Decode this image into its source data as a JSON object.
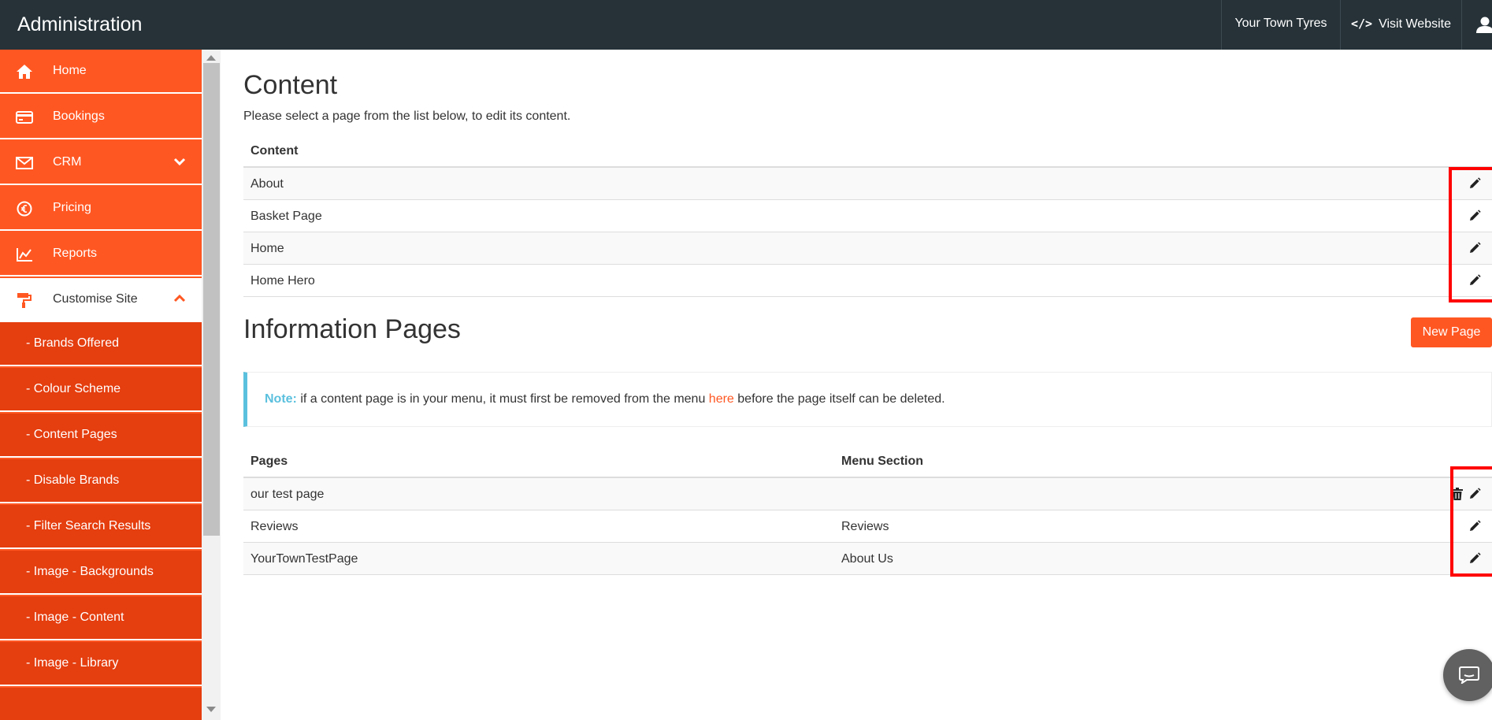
{
  "header": {
    "brand": "Administration",
    "store_name": "Your Town Tyres",
    "visit_website": "Visit Website",
    "visit_icon": "</>"
  },
  "sidebar": {
    "items": [
      {
        "label": "Home",
        "icon": "home-icon"
      },
      {
        "label": "Bookings",
        "icon": "credit-card-icon"
      },
      {
        "label": "CRM",
        "icon": "envelope-icon",
        "chevron": "chevron-down-icon"
      },
      {
        "label": "Pricing",
        "icon": "euro-icon"
      },
      {
        "label": "Reports",
        "icon": "line-chart-icon"
      },
      {
        "label": "Customise Site",
        "icon": "paint-roller-icon",
        "chevron": "chevron-up-icon",
        "active": true
      }
    ],
    "subitems": [
      "-  Brands Offered",
      "-  Colour Scheme",
      "-  Content Pages",
      "-  Disable Brands",
      "-  Filter Search Results",
      "-  Image - Backgrounds",
      "-  Image - Content",
      "-  Image - Library"
    ]
  },
  "content_section": {
    "title": "Content",
    "intro": "Please select a page from the list below, to edit its content.",
    "column_header": "Content",
    "rows": [
      "About",
      "Basket Page",
      "Home",
      "Home Hero"
    ]
  },
  "info_section": {
    "title": "Information Pages",
    "new_page_label": "New Page",
    "note": {
      "label": "Note:",
      "text_before": " if a content page is in your menu, it must first be removed from the menu ",
      "link": "here",
      "text_after": " before the page itself can be deleted."
    },
    "columns": [
      "Pages",
      "Menu Section"
    ],
    "rows": [
      {
        "page": "our test page",
        "menu": ""
      },
      {
        "page": "Reviews",
        "menu": "Reviews"
      },
      {
        "page": "YourTownTestPage",
        "menu": "About Us"
      }
    ]
  },
  "colors": {
    "topbar": "#263238",
    "accent": "#ff5722",
    "submenu": "#e53e0f",
    "note_accent": "#5bc0de",
    "highlight": "#ff0000"
  }
}
